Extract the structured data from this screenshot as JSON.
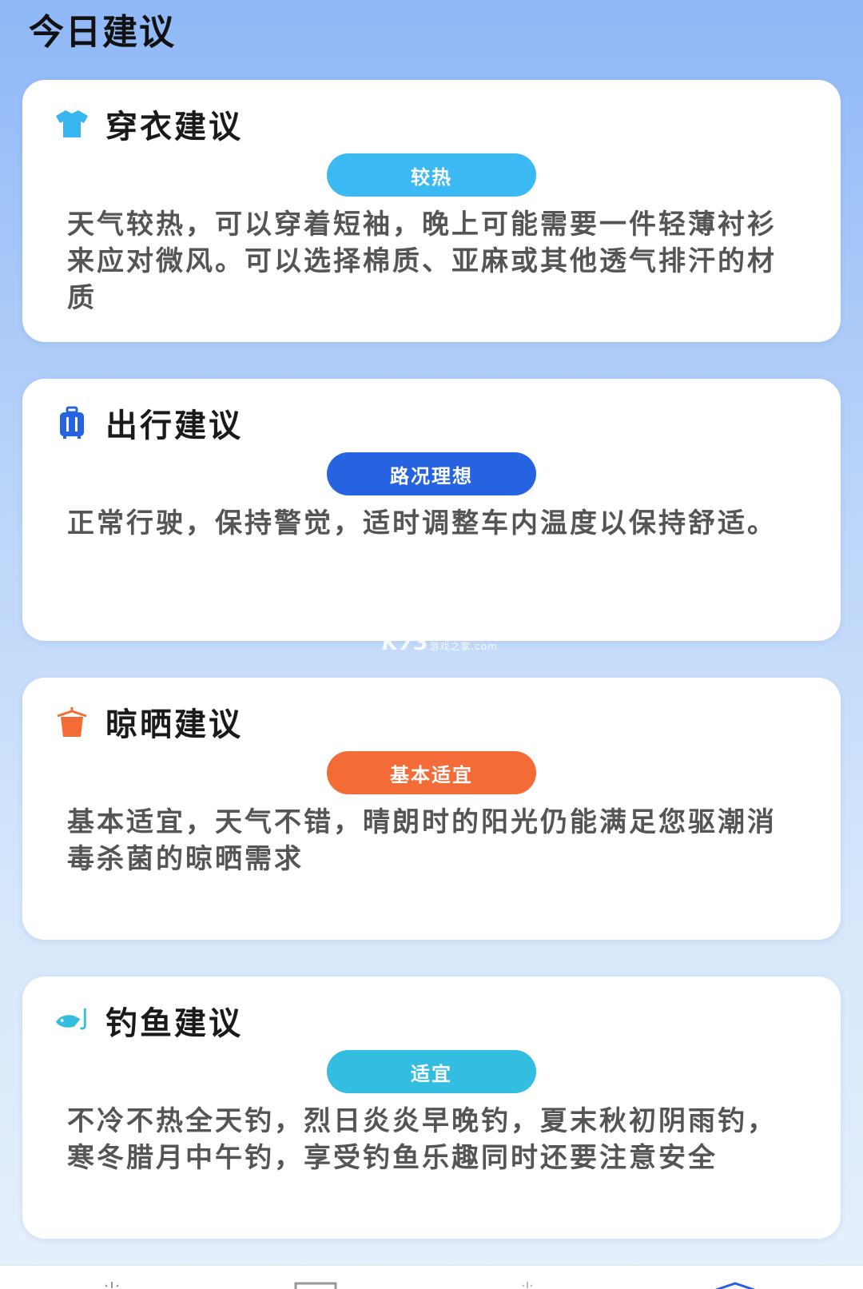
{
  "page": {
    "title": "今日建议"
  },
  "cards": [
    {
      "title": "穿衣建议",
      "icon": "tshirt-icon",
      "badge": "较热",
      "badge_color": "#3ab9f2",
      "icon_color": "#38b6f0",
      "description": "天气较热，可以穿着短袖，晚上可能需要一件轻薄衬衫来应对微风。可以选择棉质、亚麻或其他透气排汗的材质"
    },
    {
      "title": "出行建议",
      "icon": "luggage-icon",
      "badge": "路况理想",
      "badge_color": "#2563e0",
      "icon_color": "#2563e0",
      "description": "正常行驶，保持警觉，适时调整车内温度以保持舒适。"
    },
    {
      "title": "晾晒建议",
      "icon": "hanger-icon",
      "badge": "基本适宜",
      "badge_color": "#f36b36",
      "icon_color": "#f36b36",
      "description": "基本适宜，天气不错，晴朗时的阳光仍能满足您驱潮消毒杀菌的晾晒需求"
    },
    {
      "title": "钓鱼建议",
      "icon": "fishing-icon",
      "badge": "适宜",
      "badge_color": "#33bde0",
      "icon_color": "#33bde0",
      "description": "不冷不热全天钓，烈日炎炎早晚钓，夏末秋初阴雨钓，寒冬腊月中午钓，享受钓鱼乐趣同时还要注意安全"
    }
  ],
  "watermark": {
    "brand": "K73",
    "sub": "游戏之家",
    "domain": ".com"
  }
}
